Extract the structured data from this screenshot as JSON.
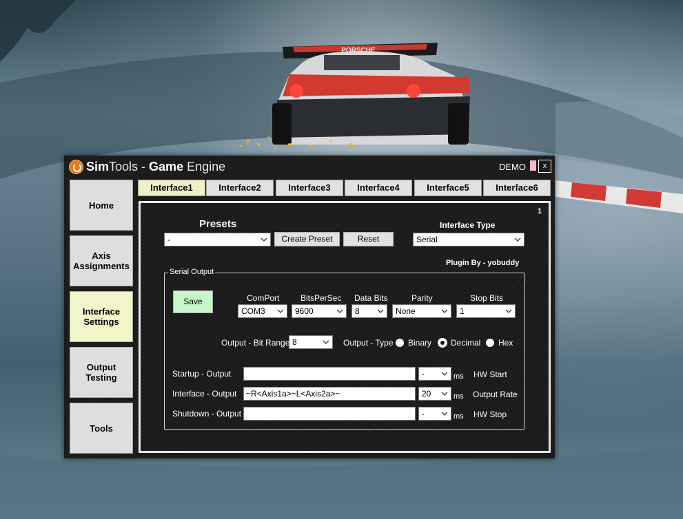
{
  "window": {
    "title_sim": "Sim",
    "title_tools": "Tools - ",
    "title_game": "Game",
    "title_engine": " Engine",
    "demo": "DEMO",
    "close": "x"
  },
  "sidebar": {
    "items": [
      {
        "label": "Home"
      },
      {
        "label": "Axis Assignments"
      },
      {
        "label": "Interface Settings"
      },
      {
        "label": "Output Testing"
      },
      {
        "label": "Tools"
      }
    ]
  },
  "tabs": [
    {
      "label": "Interface1"
    },
    {
      "label": "Interface2"
    },
    {
      "label": "Interface3"
    },
    {
      "label": "Interface4"
    },
    {
      "label": "Interface5"
    },
    {
      "label": "Interface6"
    }
  ],
  "panel": {
    "number": "1",
    "presets_label": "Presets",
    "presets_value": "-",
    "create_preset": "Create Preset",
    "reset": "Reset",
    "interface_type_label": "Interface Type",
    "interface_type_value": "Serial",
    "plugin_by": "Plugin By - yobuddy",
    "serial_output": {
      "legend": "Serial Output",
      "save": "Save",
      "comport_label": "ComPort",
      "comport_value": "COM3",
      "bitspersec_label": "BitsPerSec",
      "bitspersec_value": "9600",
      "databits_label": "Data Bits",
      "databits_value": "8",
      "parity_label": "Parity",
      "parity_value": "None",
      "stopbits_label": "Stop Bits",
      "stopbits_value": "1",
      "bitrange_label": "Output - Bit Range",
      "bitrange_value": "8",
      "outputtype_label": "Output - Type",
      "types": [
        "Binary",
        "Decimal",
        "Hex"
      ],
      "selected_type": "Decimal",
      "startup_label": "Startup - Output",
      "startup_value": "",
      "startup_ms": "-",
      "hw_start": "HW Start",
      "interface_label": "Interface - Output",
      "interface_value": "~R<Axis1a>~L<Axis2a>~",
      "interface_ms": "20",
      "output_rate": "Output Rate",
      "shutdown_label": "Shutdown - Output",
      "shutdown_value": "",
      "shutdown_ms": "-",
      "hw_stop": "HW Stop",
      "ms": "ms"
    }
  },
  "background": {
    "car_wing_text": "PORSCHE"
  }
}
